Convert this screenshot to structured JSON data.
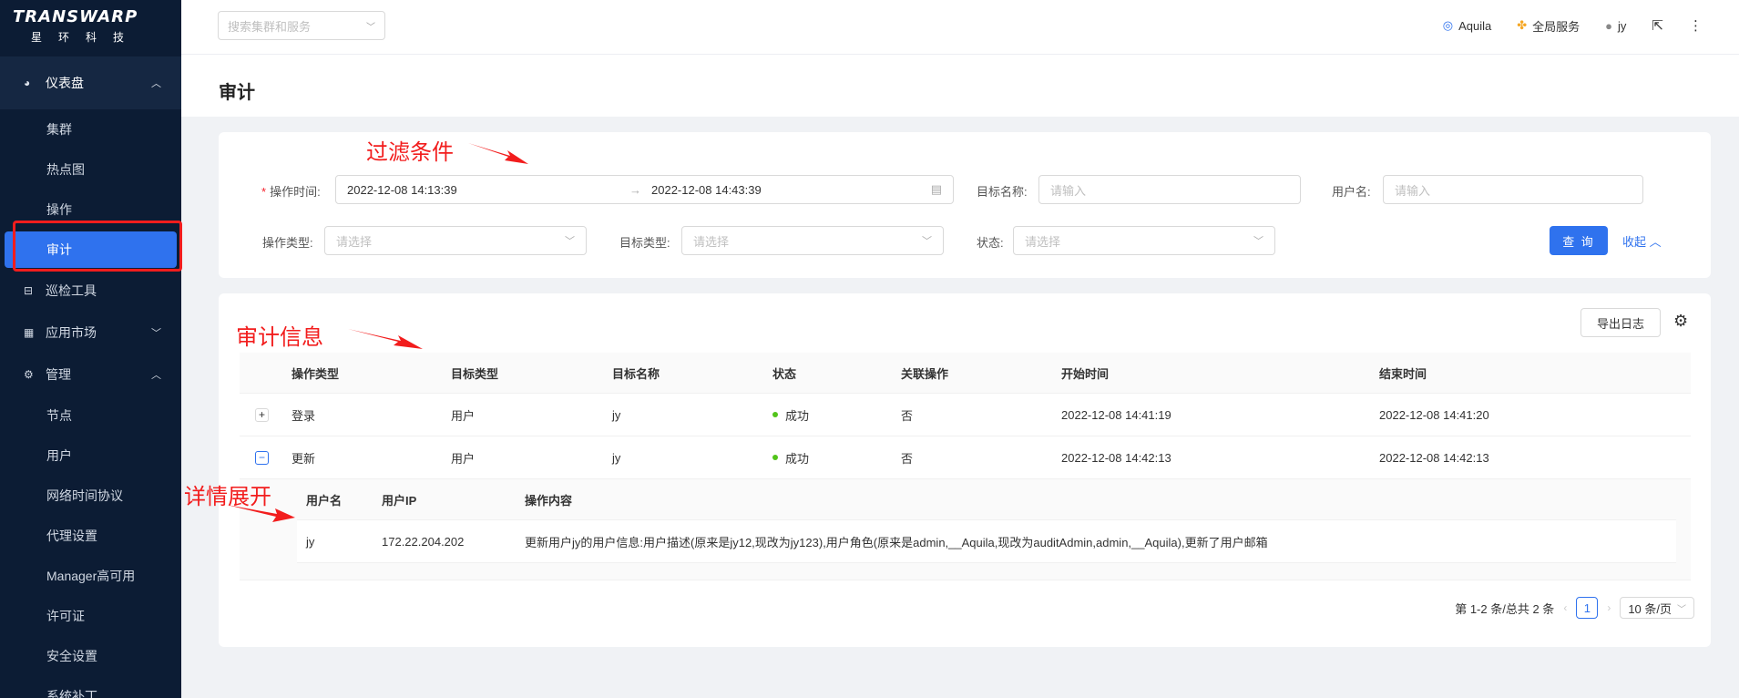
{
  "brand": {
    "name": "TRANSWARP",
    "sub": "星环科技"
  },
  "sidebar": {
    "groups": [
      {
        "label": "仪表盘",
        "icon": "dashboard-icon",
        "expanded": true,
        "items": [
          "集群",
          "热点图",
          "操作",
          "审计"
        ]
      },
      {
        "label": "巡检工具",
        "icon": "inspection-icon"
      },
      {
        "label": "应用市场",
        "icon": "app-market-icon",
        "expanded": false
      },
      {
        "label": "管理",
        "icon": "gear-icon",
        "expanded": true,
        "items": [
          "节点",
          "用户",
          "网络时间协议",
          "代理设置",
          "Manager高可用",
          "许可证",
          "安全设置",
          "系统补丁"
        ]
      }
    ],
    "active_item": "审计"
  },
  "header": {
    "search_placeholder": "搜索集群和服务",
    "aquila": "Aquila",
    "global_services": "全局服务",
    "user": "jy"
  },
  "page": {
    "title": "审计"
  },
  "filter": {
    "op_time_label": "操作时间:",
    "start_time": "2022-12-08 14:13:39",
    "end_time": "2022-12-08 14:43:39",
    "target_name_label": "目标名称:",
    "target_name_placeholder": "请输入",
    "username_label": "用户名:",
    "username_placeholder": "请输入",
    "op_type_label": "操作类型:",
    "op_type_placeholder": "请选择",
    "target_type_label": "目标类型:",
    "target_type_placeholder": "请选择",
    "status_label": "状态:",
    "status_placeholder": "请选择",
    "query_button": "查 询",
    "collapse_link": "收起"
  },
  "table": {
    "export_button": "导出日志",
    "columns": [
      "操作类型",
      "目标类型",
      "目标名称",
      "状态",
      "关联操作",
      "开始时间",
      "结束时间"
    ],
    "rows": [
      {
        "op_type": "登录",
        "target_type": "用户",
        "target_name": "jy",
        "status": "成功",
        "linked": "否",
        "start": "2022-12-08 14:41:19",
        "end": "2022-12-08 14:41:20",
        "expanded": false
      },
      {
        "op_type": "更新",
        "target_type": "用户",
        "target_name": "jy",
        "status": "成功",
        "linked": "否",
        "start": "2022-12-08 14:42:13",
        "end": "2022-12-08 14:42:13",
        "expanded": true
      }
    ],
    "detail": {
      "columns": [
        "用户名",
        "用户IP",
        "操作内容"
      ],
      "row": {
        "username": "jy",
        "ip": "172.22.204.202",
        "content": "更新用户jy的用户信息:用户描述(原来是jy12,现改为jy123),用户角色(原来是admin,__Aquila,现改为auditAdmin,admin,__Aquila),更新了用户邮箱"
      }
    },
    "pagination": {
      "summary": "第 1-2 条/总共 2 条",
      "current_page": "1",
      "page_size": "10 条/页"
    }
  },
  "annotations": {
    "filter": "过滤条件",
    "audit_info": "审计信息",
    "detail_expand": "详情展开"
  },
  "colors": {
    "sidebar_bg": "#0c1c34",
    "accent": "#2f72ee",
    "annotation": "#f21d1d",
    "success": "#52c41a"
  }
}
